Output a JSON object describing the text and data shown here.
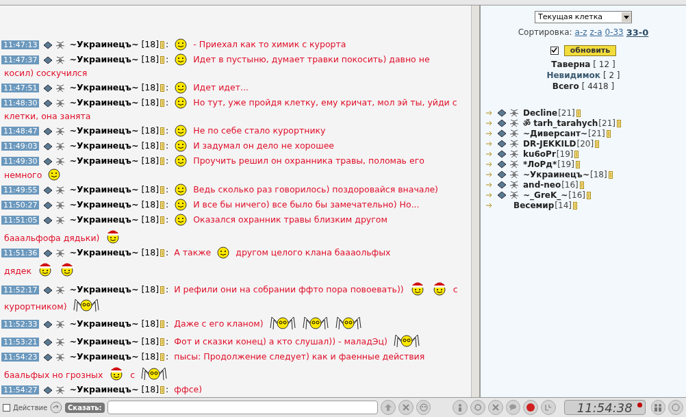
{
  "chat": {
    "messages": [
      {
        "time": "11:47:13",
        "nick": "~Украинецъ~",
        "level": "[18]",
        "separator": ":",
        "parts": [
          {
            "kind": "smiley"
          },
          {
            "kind": "text",
            "text": "- Приехал как то химик с курорта"
          }
        ]
      },
      {
        "time": "11:47:37",
        "nick": "~Украинецъ~",
        "level": "[18]",
        "separator": ":",
        "parts": [
          {
            "kind": "smiley"
          },
          {
            "kind": "text",
            "text": "Идет в пустыню, думает травки покосить) давно не"
          },
          {
            "kind": "break"
          },
          {
            "kind": "text",
            "text": "косил) соскучился"
          }
        ]
      },
      {
        "time": "11:47:51",
        "nick": "~Украинецъ~",
        "level": "[18]",
        "separator": ":",
        "parts": [
          {
            "kind": "smiley"
          },
          {
            "kind": "text",
            "text": "Идет идет..."
          }
        ]
      },
      {
        "time": "11:48:30",
        "nick": "~Украинецъ~",
        "level": "[18]",
        "separator": ":",
        "parts": [
          {
            "kind": "smiley"
          },
          {
            "kind": "text",
            "text": "Но тут, уже пройдя клетку, ему кричат, мол эй ты, уйди с"
          },
          {
            "kind": "break"
          },
          {
            "kind": "text",
            "text": "клетки, она занята"
          }
        ]
      },
      {
        "time": "11:48:47",
        "nick": "~Украинецъ~",
        "level": "[18]",
        "separator": ":",
        "parts": [
          {
            "kind": "smiley"
          },
          {
            "kind": "text",
            "text": "Не по себе стало курортнику"
          }
        ]
      },
      {
        "time": "11:49:03",
        "nick": "~Украинецъ~",
        "level": "[18]",
        "separator": ":",
        "parts": [
          {
            "kind": "smiley"
          },
          {
            "kind": "text",
            "text": "И задумал он дело не хорошее"
          }
        ]
      },
      {
        "time": "11:49:30",
        "nick": "~Украинецъ~",
        "level": "[18]",
        "separator": ":",
        "parts": [
          {
            "kind": "smiley"
          },
          {
            "kind": "text",
            "text": "Проучить решил он охранника травы, поломаь его"
          },
          {
            "kind": "break"
          },
          {
            "kind": "text",
            "text": "немного"
          },
          {
            "kind": "smiley"
          }
        ]
      },
      {
        "time": "11:49:55",
        "nick": "~Украинецъ~",
        "level": "[18]",
        "separator": ":",
        "parts": [
          {
            "kind": "smiley"
          },
          {
            "kind": "text",
            "text": "Ведь сколько раз говорилось) поздоровайся вначале)"
          }
        ]
      },
      {
        "time": "11:50:27",
        "nick": "~Украинецъ~",
        "level": "[18]",
        "separator": ":",
        "parts": [
          {
            "kind": "smiley"
          },
          {
            "kind": "text",
            "text": "И все бы ничего) все было бы замечательно) Но..."
          }
        ]
      },
      {
        "time": "11:51:05",
        "nick": "~Украинецъ~",
        "level": "[18]",
        "separator": ":",
        "parts": [
          {
            "kind": "smiley"
          },
          {
            "kind": "text",
            "text": "Оказался охранник травы близким другом"
          },
          {
            "kind": "break"
          },
          {
            "kind": "text",
            "text": "бааальфофа дядьки)"
          },
          {
            "kind": "santa"
          }
        ]
      },
      {
        "time": "11:51:36",
        "nick": "~Украинецъ~",
        "level": "[18]",
        "separator": ":",
        "parts": [
          {
            "kind": "text",
            "text": "А также"
          },
          {
            "kind": "smiley"
          },
          {
            "kind": "text",
            "text": "другом целого клана баааольфых"
          },
          {
            "kind": "break"
          },
          {
            "kind": "text",
            "text": "дядек"
          },
          {
            "kind": "santa"
          },
          {
            "kind": "santa"
          }
        ]
      },
      {
        "time": "11:52:17",
        "nick": "~Украинецъ~",
        "level": "[18]",
        "separator": ":",
        "parts": [
          {
            "kind": "text",
            "text": "И рефили они на собрании ффто пора повоевать))"
          },
          {
            "kind": "santa"
          },
          {
            "kind": "santa"
          },
          {
            "kind": "text",
            "text": "с"
          },
          {
            "kind": "break"
          },
          {
            "kind": "text",
            "text": "курортником)"
          },
          {
            "kind": "spider"
          }
        ]
      },
      {
        "time": "11:52:33",
        "nick": "~Украинецъ~",
        "level": "[18]",
        "separator": ":",
        "parts": [
          {
            "kind": "text",
            "text": "Даже с его кланом)"
          },
          {
            "kind": "spider"
          },
          {
            "kind": "spider"
          },
          {
            "kind": "spider"
          }
        ]
      },
      {
        "time": "11:53:21",
        "nick": "~Украинецъ~",
        "level": "[18]",
        "separator": ":",
        "parts": [
          {
            "kind": "text",
            "text": "Фот и сказки конец) а кто слушал)) - маладЭц)"
          },
          {
            "kind": "spider"
          }
        ]
      },
      {
        "time": "11:54:23",
        "nick": "~Украинецъ~",
        "level": "[18]",
        "separator": ":",
        "parts": [
          {
            "kind": "text",
            "text": "пысы: Продолжение следует) как и фаенные действия"
          },
          {
            "kind": "break"
          },
          {
            "kind": "text",
            "text": "баальфых но грозных"
          },
          {
            "kind": "santa"
          },
          {
            "kind": "text",
            "text": "с"
          },
          {
            "kind": "spider"
          }
        ]
      },
      {
        "time": "11:54:27",
        "nick": "~Украинецъ~",
        "level": "[18]",
        "separator": ":",
        "parts": [
          {
            "kind": "text",
            "text": "ффсе)"
          }
        ]
      }
    ]
  },
  "sidebar": {
    "location_select": "Текущая клетка",
    "sort_label": "Сортировка:",
    "sort_links": [
      {
        "label": "a-z",
        "selected": false
      },
      {
        "label": "z-a",
        "selected": false
      },
      {
        "label": "0-33",
        "selected": false
      },
      {
        "label": "33-0",
        "selected": true
      }
    ],
    "auto_refresh": {
      "checked": true
    },
    "refresh_button": "обновить",
    "counts": [
      {
        "label": "Таверна",
        "value": "[ 12 ]",
        "kind": "plain"
      },
      {
        "label": "Невидимок",
        "value": "[ 2 ]",
        "kind": "link"
      },
      {
        "label": "Всего",
        "value": "[ 4418 ]",
        "kind": "plain"
      }
    ],
    "users": [
      {
        "name": "Decline",
        "level": "[21]",
        "emblems": true
      },
      {
        "name": "ॐ tarh_tarahych",
        "level": "[21]",
        "emblems": true
      },
      {
        "name": "~Диверсант~",
        "level": "[21]",
        "emblems": true
      },
      {
        "name": "DR-JEKKILD",
        "level": "[20]",
        "emblems": true
      },
      {
        "name": "ku6oPr",
        "level": "[19]",
        "emblems": true
      },
      {
        "name": "*ЛоРд*",
        "level": "[19]",
        "emblems": true
      },
      {
        "name": "~Украинецъ~",
        "level": "[18]",
        "emblems": true
      },
      {
        "name": "and-neo",
        "level": "[16]",
        "emblems": true
      },
      {
        "name": "~_GreK_~",
        "level": "[16]",
        "emblems": true
      },
      {
        "name": "Весемир",
        "level": "[14]",
        "emblems": false
      }
    ]
  },
  "bottom_bar": {
    "action": {
      "label": "Действие",
      "checked": false
    },
    "say_label": "Сказать:",
    "clock": "11:54:38"
  }
}
